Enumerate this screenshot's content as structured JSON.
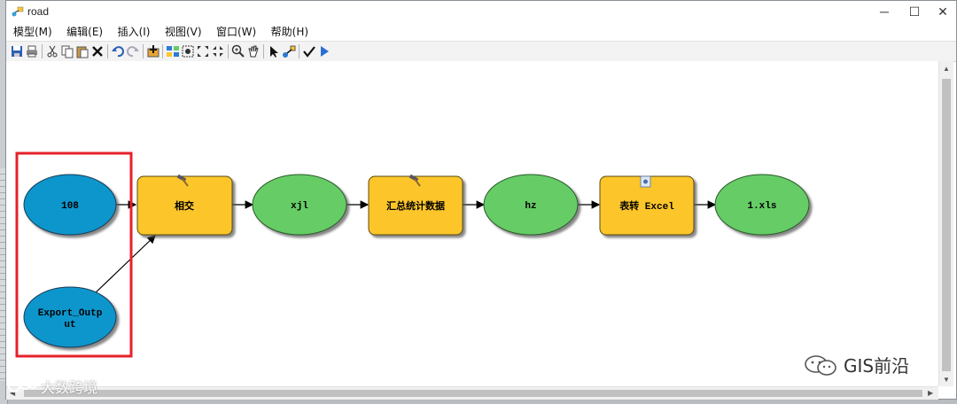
{
  "window": {
    "title": "road",
    "minimize": "─",
    "maximize": "☐",
    "close": "✕"
  },
  "menu": [
    "模型(M)",
    "编辑(E)",
    "插入(I)",
    "视图(V)",
    "窗口(W)",
    "帮助(H)"
  ],
  "toolbar": {
    "icons": [
      "save-icon",
      "print-icon",
      "cut-icon",
      "copy-icon",
      "paste-icon",
      "delete-icon",
      "undo-icon",
      "redo-icon",
      "add-data-icon",
      "auto-layout-icon",
      "full-extent-icon",
      "zoom-in-fixed-icon",
      "zoom-out-fixed-icon",
      "zoom-in-icon",
      "pan-icon",
      "select-icon",
      "connect-icon",
      "validate-icon",
      "run-icon"
    ]
  },
  "model": {
    "nodes": [
      {
        "id": "108",
        "label": "108",
        "kind": "input",
        "color": "#0a96cc"
      },
      {
        "id": "export",
        "label_lines": [
          "Export_Outp",
          "ut"
        ],
        "kind": "input",
        "color": "#0a96cc"
      },
      {
        "id": "intersect",
        "label": "相交",
        "kind": "tool",
        "color": "#fcc62c"
      },
      {
        "id": "xjl",
        "label": "xjl",
        "kind": "output",
        "color": "#66cc66"
      },
      {
        "id": "summary",
        "label": "汇总统计数据",
        "kind": "tool",
        "color": "#fcc62c"
      },
      {
        "id": "hz",
        "label": "hz",
        "kind": "output",
        "color": "#66cc66"
      },
      {
        "id": "toexcel",
        "label": "表转 Excel",
        "kind": "tool",
        "color": "#fcc62c"
      },
      {
        "id": "xls",
        "label": "1.xls",
        "kind": "output",
        "color": "#66cc66"
      }
    ],
    "highlight_color": "#e6202a"
  },
  "watermarks": {
    "left": "大数跨境",
    "right": "GIS前沿"
  }
}
